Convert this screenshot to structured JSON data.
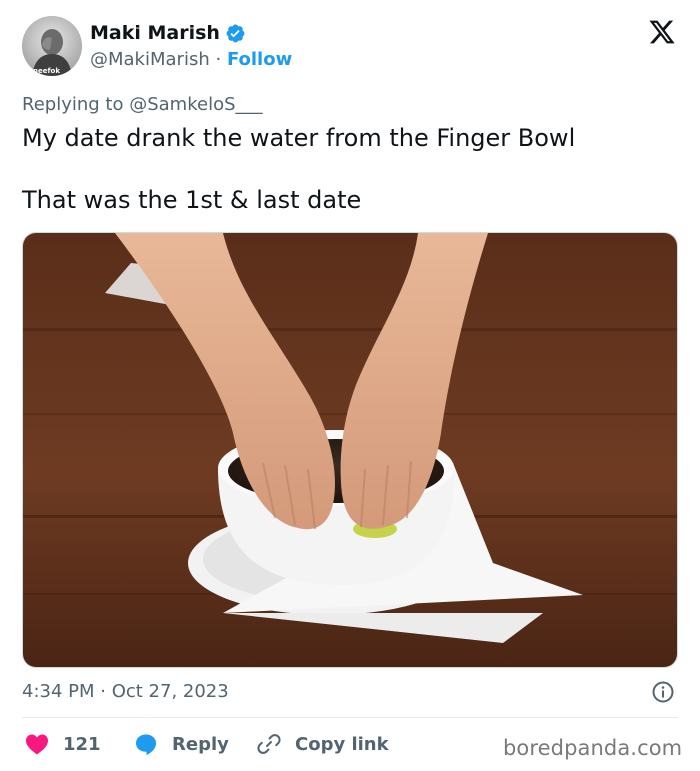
{
  "author": {
    "name": "Maki Marish",
    "handle": "@MakiMarish",
    "separator": "·",
    "follow_label": "Follow",
    "avatar_watermark": "gneefok",
    "verified_color": "#1d9bf0"
  },
  "reply": {
    "prefix": "Replying to",
    "mention": "@SamkeloS___"
  },
  "tweet": {
    "line1": "My date drank the water from the Finger Bowl",
    "line2": "That was the 1st & last date"
  },
  "media": {
    "icon": "photo-hands-in-finger-bowl"
  },
  "meta": {
    "timestamp": "4:34 PM · Oct 27, 2023"
  },
  "actions": {
    "like_count": "121",
    "reply_label": "Reply",
    "copy_link_label": "Copy link"
  },
  "colors": {
    "accent": "#1d9bf0",
    "like": "#f91880",
    "muted": "#536471"
  },
  "watermark": "boredpanda.com"
}
